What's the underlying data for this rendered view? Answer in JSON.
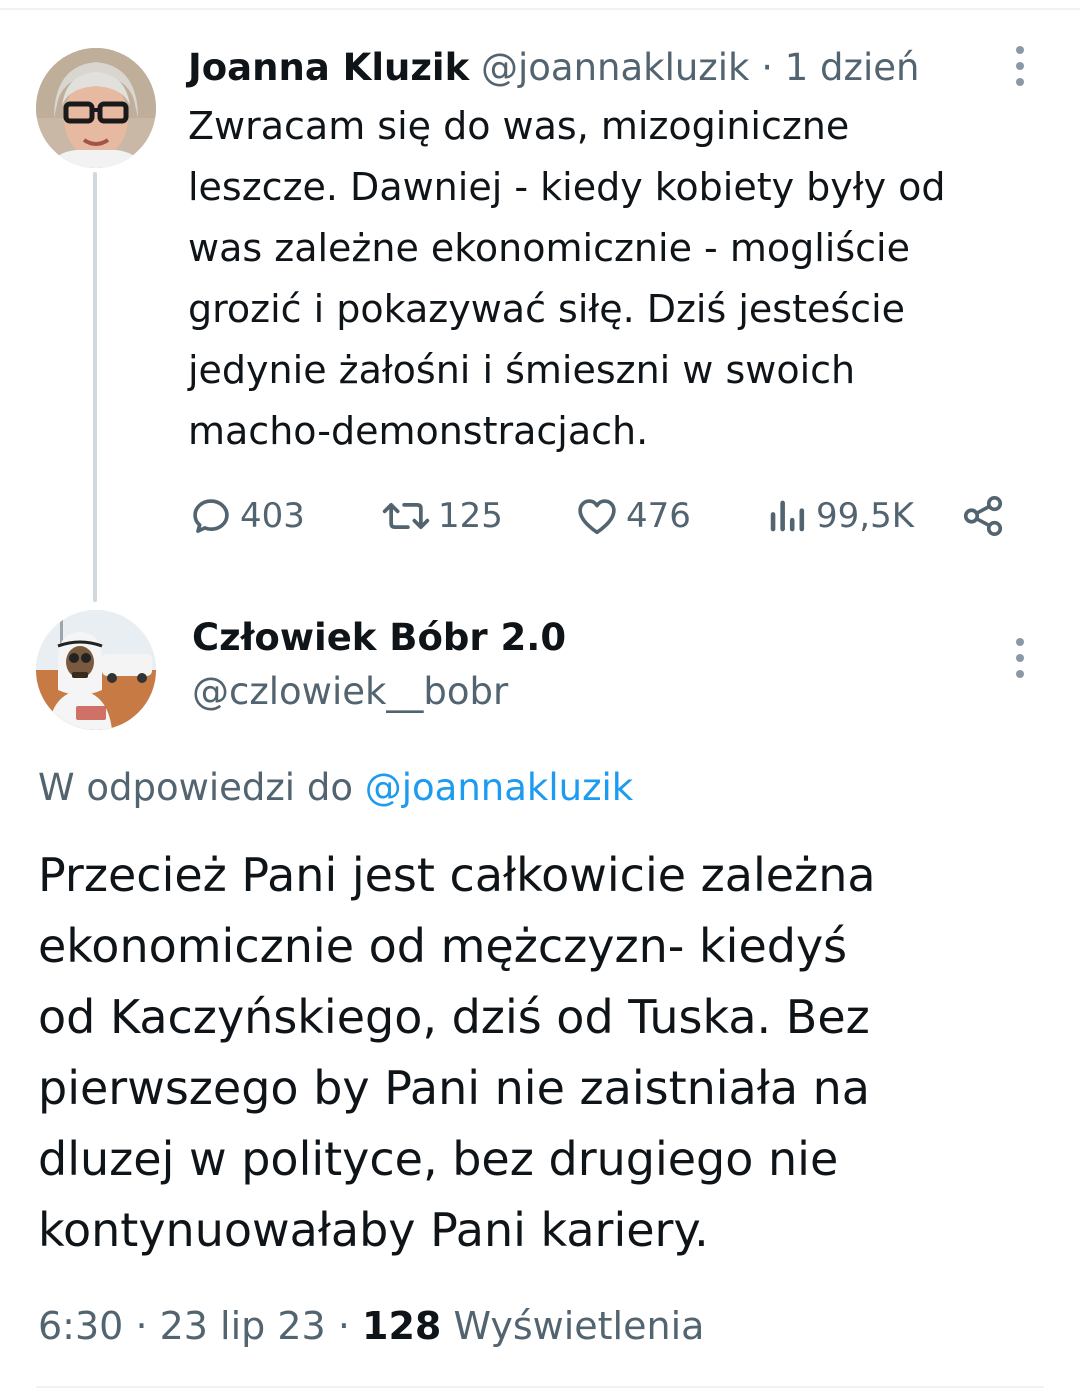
{
  "tweet1": {
    "name": "Joanna Kluzik",
    "handle": "@joannakluzik",
    "separator": "·",
    "time": "1 dzień",
    "text_lines": [
      "Zwracam się do was, mizoginiczne",
      "leszcze. Dawniej - kiedy kobiety były od",
      "was zależne ekonomicznie - mogliście",
      "grozić i pokazywać siłę. Dziś jesteście",
      "jedynie żałośni i śmieszni w swoich",
      "macho-demonstracjach."
    ],
    "stats": {
      "replies": "403",
      "retweets": "125",
      "likes": "476",
      "views": "99,5K"
    }
  },
  "tweet2": {
    "name": "Człowiek Bóbr 2.0",
    "handle": "@czlowiek__bobr",
    "reply_prefix": "W odpowiedzi do",
    "reply_to": "@joannakluzik",
    "text_lines": [
      "Przecież Pani jest całkowicie zależna",
      "ekonomicznie od mężczyzn- kiedyś",
      "od Kaczyńskiego, dziś od Tuska. Bez",
      "pierwszego by Pani nie zaistniała na",
      "dluzej w polityce, bez drugiego nie",
      "kontynuowałaby Pani kariery."
    ],
    "time": "6:30",
    "date": "23 lip 23",
    "separator": "·",
    "views_count": "128",
    "views_label": "Wyświetlenia"
  },
  "colors": {
    "text": "#0f1419",
    "secondary": "#536471",
    "link": "#1d9bf0",
    "thread_line": "#cfd9de"
  }
}
